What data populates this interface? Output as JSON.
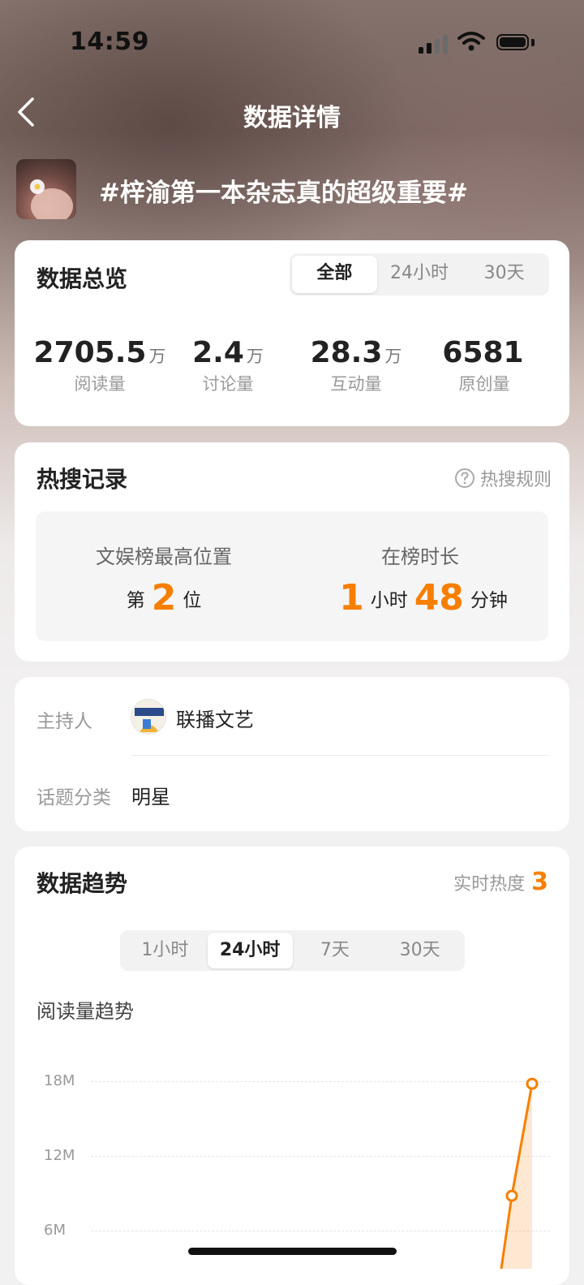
{
  "status_bar": {
    "time": "14:59"
  },
  "header": {
    "title": "数据详情",
    "topic": "#梓渝第一本杂志真的超级重要#"
  },
  "overview": {
    "title": "数据总览",
    "tabs": [
      "全部",
      "24小时",
      "30天"
    ],
    "active_tab": "全部",
    "stats": [
      {
        "value": "2705.5",
        "unit": "万",
        "label": "阅读量"
      },
      {
        "value": "2.4",
        "unit": "万",
        "label": "讨论量"
      },
      {
        "value": "28.3",
        "unit": "万",
        "label": "互动量"
      },
      {
        "value": "6581",
        "unit": "",
        "label": "原创量"
      }
    ]
  },
  "hot_search": {
    "title": "热搜记录",
    "rules_label": "热搜规则",
    "best_position_label": "文娱榜最高位置",
    "position_prefix": "第",
    "position_value": "2",
    "position_suffix": "位",
    "duration_label": "在榜时长",
    "hours_value": "1",
    "hours_unit": "小时",
    "minutes_value": "48",
    "minutes_unit": "分钟"
  },
  "info": {
    "host_label": "主持人",
    "host_name": "联播文艺",
    "category_label": "话题分类",
    "category_value": "明星"
  },
  "trend": {
    "title": "数据趋势",
    "realtime_label": "实时热度",
    "realtime_value": "3",
    "tabs": [
      "1小时",
      "24小时",
      "7天",
      "30天"
    ],
    "active_tab": "24小时",
    "chart_title": "阅读量趋势",
    "accent": "#f77f00"
  },
  "chart_data": {
    "type": "area",
    "title": "阅读量趋势",
    "y_ticks": [
      "18M",
      "12M",
      "6M"
    ],
    "ylim": [
      0,
      18000000
    ],
    "series": [
      {
        "values": [
          8800000,
          17800000
        ]
      }
    ],
    "grid": true
  }
}
